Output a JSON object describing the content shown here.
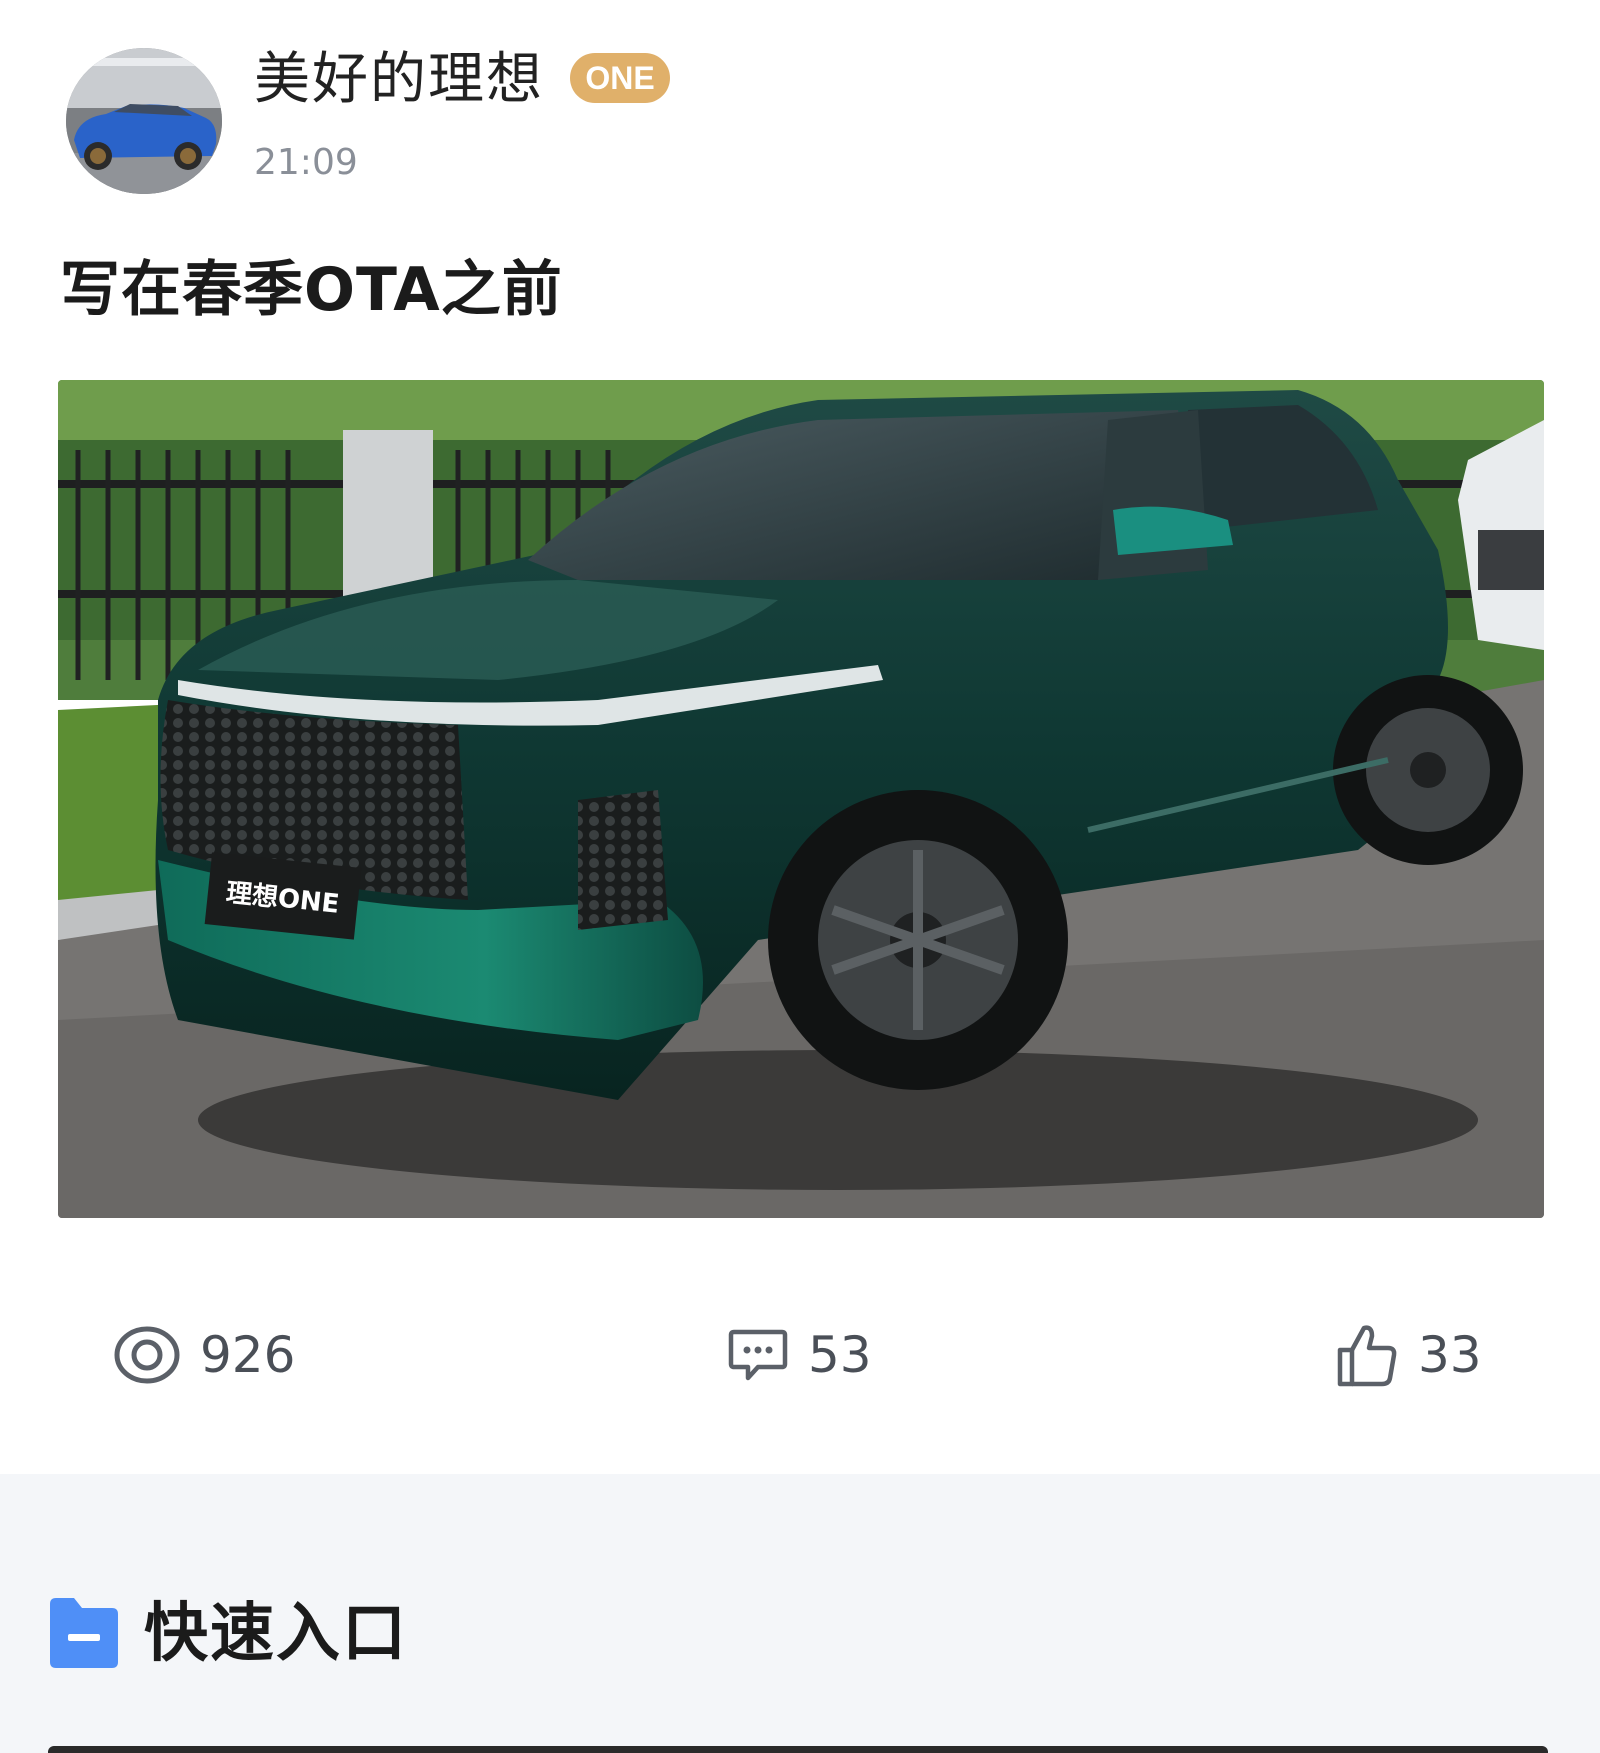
{
  "post": {
    "author": {
      "name": "美好的理想",
      "badge": "ONE"
    },
    "time": "21:09",
    "title": "写在春季OTA之前",
    "image_plate_text": "理想ONE",
    "stats": {
      "views": "926",
      "comments": "53",
      "likes": "33"
    }
  },
  "section": {
    "title": "快速入口",
    "icon": "folder-icon"
  },
  "colors": {
    "badge": "#e0b06a",
    "stat_icon": "#5b6068",
    "folder_icon": "#4f8ff7",
    "section_bg": "#f4f6f9"
  }
}
